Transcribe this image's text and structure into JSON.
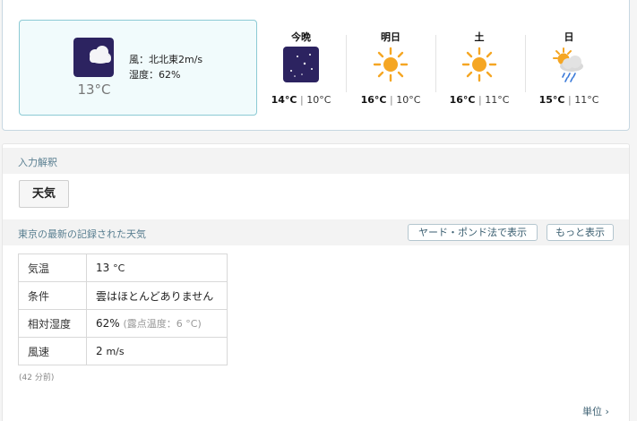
{
  "current": {
    "temperature": "13°C",
    "wind": "風：北北東2m/s",
    "humidity": "湿度：62%",
    "icon": "cloudy-night-icon"
  },
  "forecast": [
    {
      "label": "今晩",
      "high": "14°C",
      "low": "10°C",
      "icon": "starry-night-icon"
    },
    {
      "label": "明日",
      "high": "16°C",
      "low": "10°C",
      "icon": "sun-icon"
    },
    {
      "label": "土",
      "high": "16°C",
      "low": "11°C",
      "icon": "sun-icon"
    },
    {
      "label": "日",
      "high": "15°C",
      "low": "11°C",
      "icon": "sun-rain-cloud-icon"
    }
  ],
  "pod": {
    "input_label": "入力解釈",
    "input_value": "天気",
    "result_label": "東京の最新の記録された天気",
    "imperial_button": "ヤード・ポンド法で表示",
    "more_button": "もっと表示",
    "rows": [
      {
        "key": "気温",
        "value": "13",
        "unit": "°C",
        "note": ""
      },
      {
        "key": "条件",
        "value": "雲はほとんどありません",
        "unit": "",
        "note": ""
      },
      {
        "key": "相対湿度",
        "value": "62%",
        "unit": "",
        "note": "(露点温度：6 °C)"
      },
      {
        "key": "風速",
        "value": "2",
        "unit": "m/s",
        "note": ""
      }
    ],
    "ago": "(42 分前)",
    "units_link": "単位 ›"
  },
  "colors": {
    "accent_border": "#8ccad4",
    "link": "#3a5e70",
    "sun": "#f5a623",
    "night": "#2c2360"
  }
}
